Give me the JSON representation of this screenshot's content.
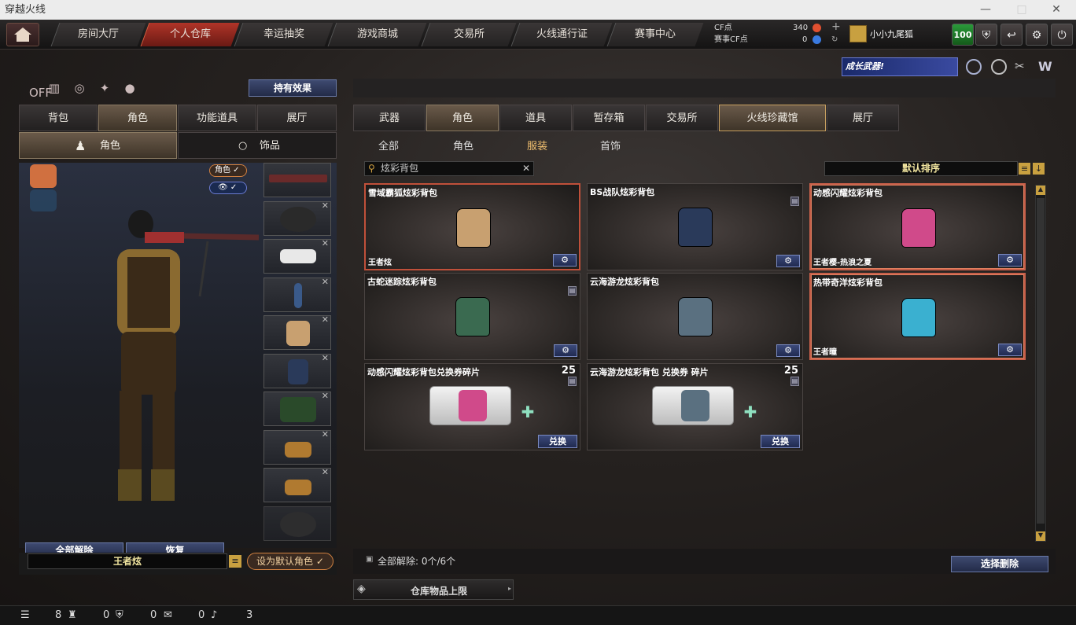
{
  "window": {
    "title": "穿越火线",
    "min": "—",
    "max": "□",
    "close": "✕"
  },
  "nav": {
    "home_icon": "home-icon",
    "tabs": [
      "房间大厅",
      "个人仓库",
      "幸运抽奖",
      "游戏商城",
      "交易所",
      "火线通行证",
      "赛事中心"
    ],
    "active": "个人仓库"
  },
  "currency": {
    "cf_label": "CF点",
    "cf_value": "340",
    "match_label": "赛事CF点",
    "match_value": "0"
  },
  "user": {
    "name": "小小九尾狐",
    "level": "100"
  },
  "left": {
    "effect_button": "持有效果",
    "off_label": "OFF",
    "tabs": [
      "背包",
      "角色",
      "功能道具",
      "展厅"
    ],
    "active_tab": "角色",
    "subtabs": [
      "角色",
      "饰品"
    ],
    "role_toggle": "角色",
    "clear_all": "全部解除",
    "restore": "恢复",
    "char_name": "王者炫",
    "set_default": "设为默认角色"
  },
  "right": {
    "tabs": [
      "武器",
      "角色",
      "道具",
      "暂存箱",
      "交易所",
      "火线珍藏馆",
      "展厅"
    ],
    "active_tab": "火线珍藏馆",
    "subtabs": [
      "全部",
      "角色",
      "服装",
      "首饰"
    ],
    "active_subtab": "服装",
    "search_value": "炫彩背包",
    "sort_label": "默认排序",
    "banner": "成长武器!"
  },
  "items": [
    {
      "name": "雪域霸狐炫彩背包",
      "tag": "王者炫",
      "color": "#c8a070"
    },
    {
      "name": "BS战队炫彩背包",
      "tag": "",
      "color": "#2a3a5a"
    },
    {
      "name": "动感闪耀炫彩背包",
      "tag": "王者樱-热浪之夏",
      "color": "#d04a8a"
    },
    {
      "name": "古蛇迷踪炫彩背包",
      "tag": "",
      "color": "#3a6a50"
    },
    {
      "name": "云海游龙炫彩背包",
      "tag": "",
      "color": "#5a7080"
    },
    {
      "name": "热带奇洋炫彩背包",
      "tag": "王者瞳",
      "color": "#3ab0d0"
    },
    {
      "name": "动感闪耀炫彩背包兑换券碎片",
      "count": "25",
      "action": "兑换",
      "color": "#d04a8a"
    },
    {
      "name": "云海游龙炫彩背包 兑换券 碎片",
      "count": "25",
      "action": "兑换",
      "color": "#5a7080"
    }
  ],
  "footer": {
    "clear_summary": "全部解除: 0个/6个",
    "bulk_delete": "选择删除",
    "capacity": "仓库物品上限"
  },
  "status": {
    "a": "8",
    "b": "0",
    "c": "0",
    "d": "0",
    "e": "3"
  }
}
